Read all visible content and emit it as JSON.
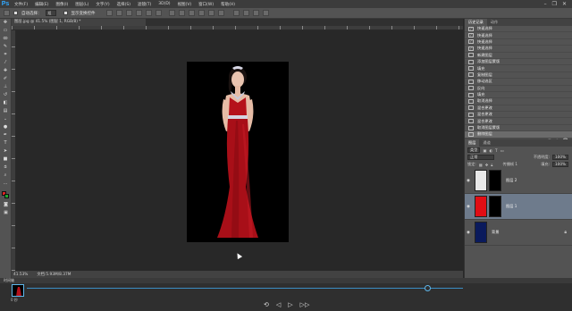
{
  "app": {
    "logo": "Ps"
  },
  "menu": {
    "items": [
      "文件(F)",
      "编辑(E)",
      "图像(I)",
      "图层(L)",
      "文字(Y)",
      "选择(S)",
      "滤镜(T)",
      "3D(D)",
      "视图(V)",
      "窗口(W)",
      "帮助(H)"
    ]
  },
  "window_controls": {
    "minimize": "–",
    "restore": "❐",
    "close": "✕"
  },
  "options_bar": {
    "auto_select_label": "自动选择：",
    "auto_select_value": "组",
    "show_transform_label": "显示变换控件"
  },
  "document": {
    "tab_title": "图层.jpg @ 41.5% (图层 1, RGB/8) *"
  },
  "status": {
    "zoom": "41.53%",
    "doc_size": "文档:5.93M/8.37M"
  },
  "timeline": {
    "header": "时间轴",
    "frame_label": "0 秒",
    "controls": [
      "⟲",
      "◁",
      "▷",
      "▷▷"
    ]
  },
  "history": {
    "tabs": [
      "历史记录",
      "动作"
    ],
    "items": [
      {
        "label": "快速选择",
        "icon": "brush-icon"
      },
      {
        "label": "快速选择",
        "icon": "brush-icon"
      },
      {
        "label": "快速选择",
        "icon": "brush-icon"
      },
      {
        "label": "快速选择",
        "icon": "brush-icon"
      },
      {
        "label": "新建图层",
        "icon": "layer-icon"
      },
      {
        "label": "添加图层蒙版",
        "icon": "layer-icon"
      },
      {
        "label": "填充",
        "icon": "layer-icon"
      },
      {
        "label": "复制图层",
        "icon": "layer-icon"
      },
      {
        "label": "移动选区",
        "icon": "layer-icon"
      },
      {
        "label": "反向",
        "icon": "layer-icon"
      },
      {
        "label": "填充",
        "icon": "layer-icon"
      },
      {
        "label": "取消选择",
        "icon": "layer-icon"
      },
      {
        "label": "混合更改",
        "icon": "layer-icon"
      },
      {
        "label": "混合更改",
        "icon": "layer-icon"
      },
      {
        "label": "混合更改",
        "icon": "layer-icon"
      },
      {
        "label": "取消图层蒙版",
        "icon": "layer-icon"
      },
      {
        "label": "删除图层",
        "icon": "layer-icon"
      }
    ],
    "active_index": 16
  },
  "layers": {
    "tabs": [
      "图层",
      "通道"
    ],
    "kind_filter": "类型",
    "blend_mode": "正常",
    "opacity_label": "不透明度:",
    "opacity_value": "100%",
    "lock_label": "锁定:",
    "fill_label": "填充:",
    "fill_value": "100%",
    "propagate_label": "传播帧 1",
    "items": [
      {
        "name": "图层 2",
        "selected": false,
        "thumb_color": "#e8e8e8",
        "mask_color": "#000000"
      },
      {
        "name": "图层 1",
        "selected": true,
        "thumb_color": "#e10d14",
        "mask_color": "#000000"
      },
      {
        "name": "背景",
        "selected": false,
        "thumb_color": "#0a1a5c",
        "mask_color": ""
      }
    ]
  },
  "colors": {
    "accent": "#31a8ff",
    "foreground": "#e02424",
    "background": "#1fa82b",
    "dress": "#b5121b"
  }
}
